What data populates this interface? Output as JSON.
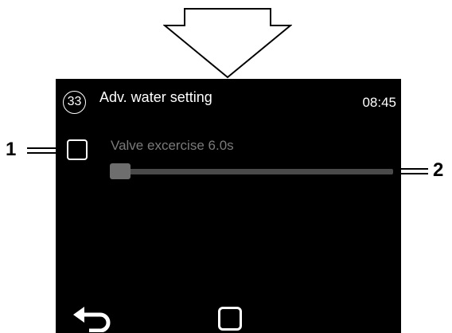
{
  "screen": {
    "menu_number": "33",
    "title": "Adv. water setting",
    "time": "08:45",
    "setting": {
      "label": "Valve excercise 6.0s",
      "checkbox_checked": false,
      "slider_fraction": 0.0
    },
    "footer": {
      "back_icon": "back-arrow-icon",
      "home_icon": "home-square-icon"
    }
  },
  "callouts": {
    "checkbox_number": "1",
    "slider_number": "2"
  },
  "colors": {
    "screen_background": "#000000",
    "text_primary": "#ffffff",
    "text_disabled": "#7a7a7a",
    "slider_track": "#4a4a4a",
    "slider_thumb": "#6e6e6e"
  }
}
